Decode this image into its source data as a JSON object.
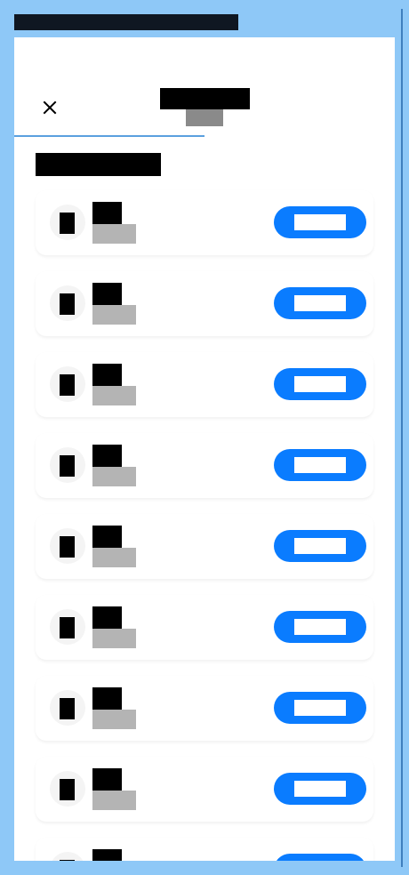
{
  "top_bar": {
    "title": ""
  },
  "header": {
    "close_icon": "close-icon",
    "title": "",
    "subtitle": ""
  },
  "section": {
    "title": ""
  },
  "items": [
    {
      "avatar_icon": "phone-icon",
      "title": "",
      "subtitle": "",
      "button_label": ""
    },
    {
      "avatar_icon": "phone-icon",
      "title": "",
      "subtitle": "",
      "button_label": ""
    },
    {
      "avatar_icon": "phone-icon",
      "title": "",
      "subtitle": "",
      "button_label": ""
    },
    {
      "avatar_icon": "phone-icon",
      "title": "",
      "subtitle": "",
      "button_label": ""
    },
    {
      "avatar_icon": "phone-icon",
      "title": "",
      "subtitle": "",
      "button_label": ""
    },
    {
      "avatar_icon": "phone-icon",
      "title": "",
      "subtitle": "",
      "button_label": ""
    },
    {
      "avatar_icon": "phone-icon",
      "title": "",
      "subtitle": "",
      "button_label": ""
    },
    {
      "avatar_icon": "phone-icon",
      "title": "",
      "subtitle": "",
      "button_label": ""
    },
    {
      "avatar_icon": "phone-icon",
      "title": "",
      "subtitle": "",
      "button_label": ""
    }
  ],
  "colors": {
    "background": "#8ec8f7",
    "panel": "#ffffff",
    "accent": "#0a7cff",
    "tab_indicator": "#5ba0df",
    "redaction_dark": "#000000",
    "redaction_muted": "#b4b4b4"
  }
}
